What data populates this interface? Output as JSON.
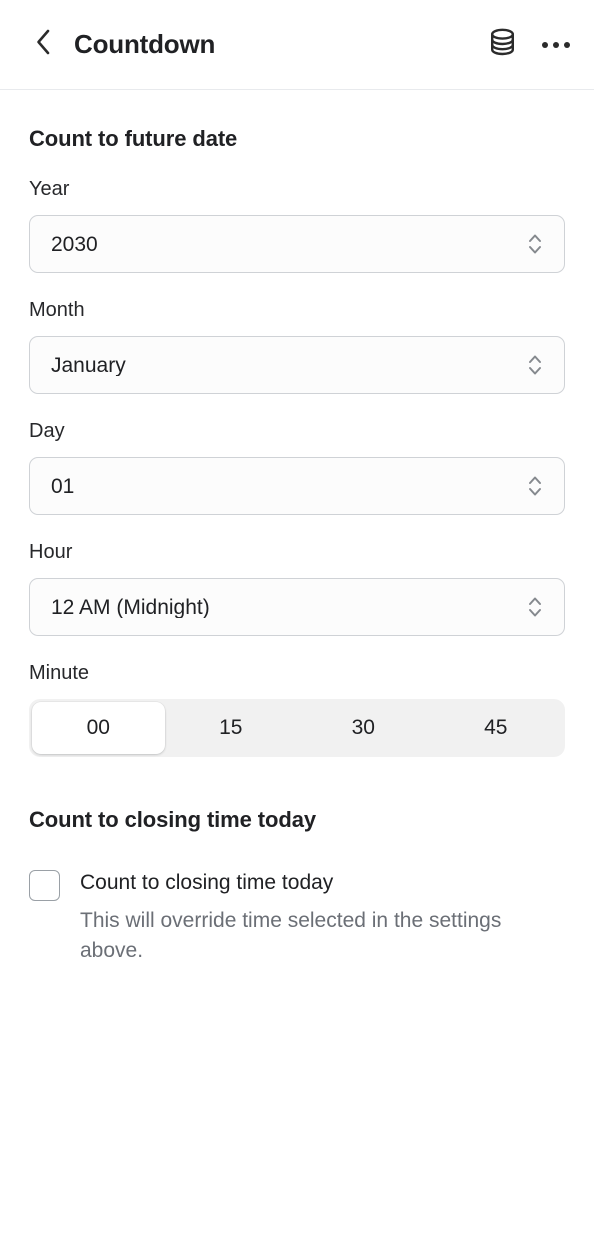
{
  "header": {
    "back_icon": "chevron-left-icon",
    "title": "Countdown",
    "database_icon": "database-icon",
    "more_icon": "more-horizontal-icon"
  },
  "sections": {
    "future_date": {
      "title": "Count to future date",
      "fields": {
        "year": {
          "label": "Year",
          "value": "2030",
          "stepper_icon": "chevron-up-down-icon"
        },
        "month": {
          "label": "Month",
          "value": "January",
          "stepper_icon": "chevron-up-down-icon"
        },
        "day": {
          "label": "Day",
          "value": "01",
          "stepper_icon": "chevron-up-down-icon"
        },
        "hour": {
          "label": "Hour",
          "value": "12 AM (Midnight)",
          "stepper_icon": "chevron-up-down-icon"
        },
        "minute": {
          "label": "Minute",
          "options": [
            "00",
            "15",
            "30",
            "45"
          ],
          "selected": "00"
        }
      }
    },
    "closing_time": {
      "title": "Count to closing time today",
      "checkbox": {
        "label": "Count to closing time today",
        "checked": false,
        "help": "This will override time selected in the settings above."
      }
    }
  },
  "colors": {
    "text": "#202124",
    "muted": "#6b6f76",
    "border": "#cfd2d6",
    "field_bg": "#fcfcfc",
    "track_bg": "#f1f1f1",
    "divider": "#e8eaed"
  }
}
